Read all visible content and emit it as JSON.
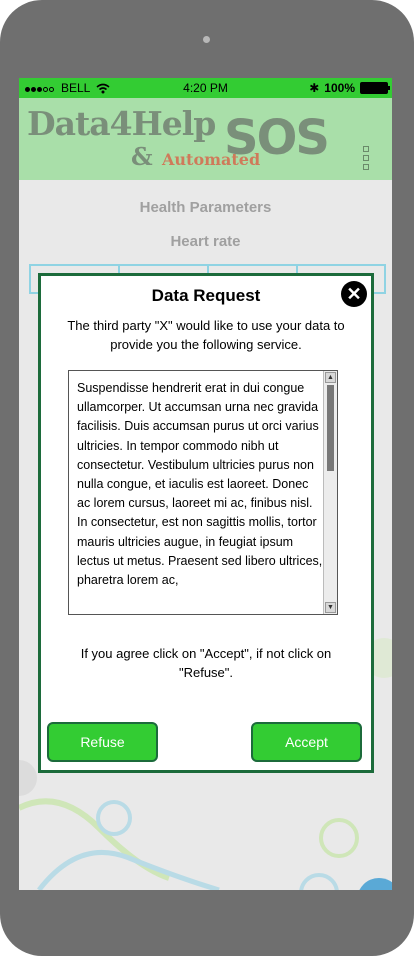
{
  "status_bar": {
    "carrier": "BELL",
    "time": "4:20 PM",
    "battery": "100%"
  },
  "header": {
    "logo_data": "Data4Help",
    "logo_amp": "&",
    "logo_automated": "Automated",
    "logo_sos": "SOS"
  },
  "background": {
    "title": "Health Parameters",
    "subtitle": "Heart rate"
  },
  "modal": {
    "title": "Data Request",
    "intro": "The third party \"X\" would like to use your data to provide you the following service.",
    "body": "Suspendisse hendrerit erat in dui congue ullamcorper. Ut accumsan urna nec gravida facilisis. Duis accumsan purus ut orci varius ultricies. In tempor commodo nibh ut consectetur. Vestibulum ultricies purus non nulla congue, et iaculis est laoreet. Donec ac lorem cursus, laoreet mi ac, finibus nisl. In consectetur, est non sagittis mollis, tortor mauris ultricies augue, in feugiat ipsum lectus ut metus. Praesent sed libero ultrices, pharetra lorem ac,",
    "agree_text": "If you agree click on \"Accept\", if not click on \"Refuse\".",
    "refuse_label": "Refuse",
    "accept_label": "Accept"
  },
  "colors": {
    "status_green": "#33cc33",
    "header_green": "#a9dfa9",
    "modal_border": "#1c6b3b",
    "button_green": "#33cc33"
  }
}
